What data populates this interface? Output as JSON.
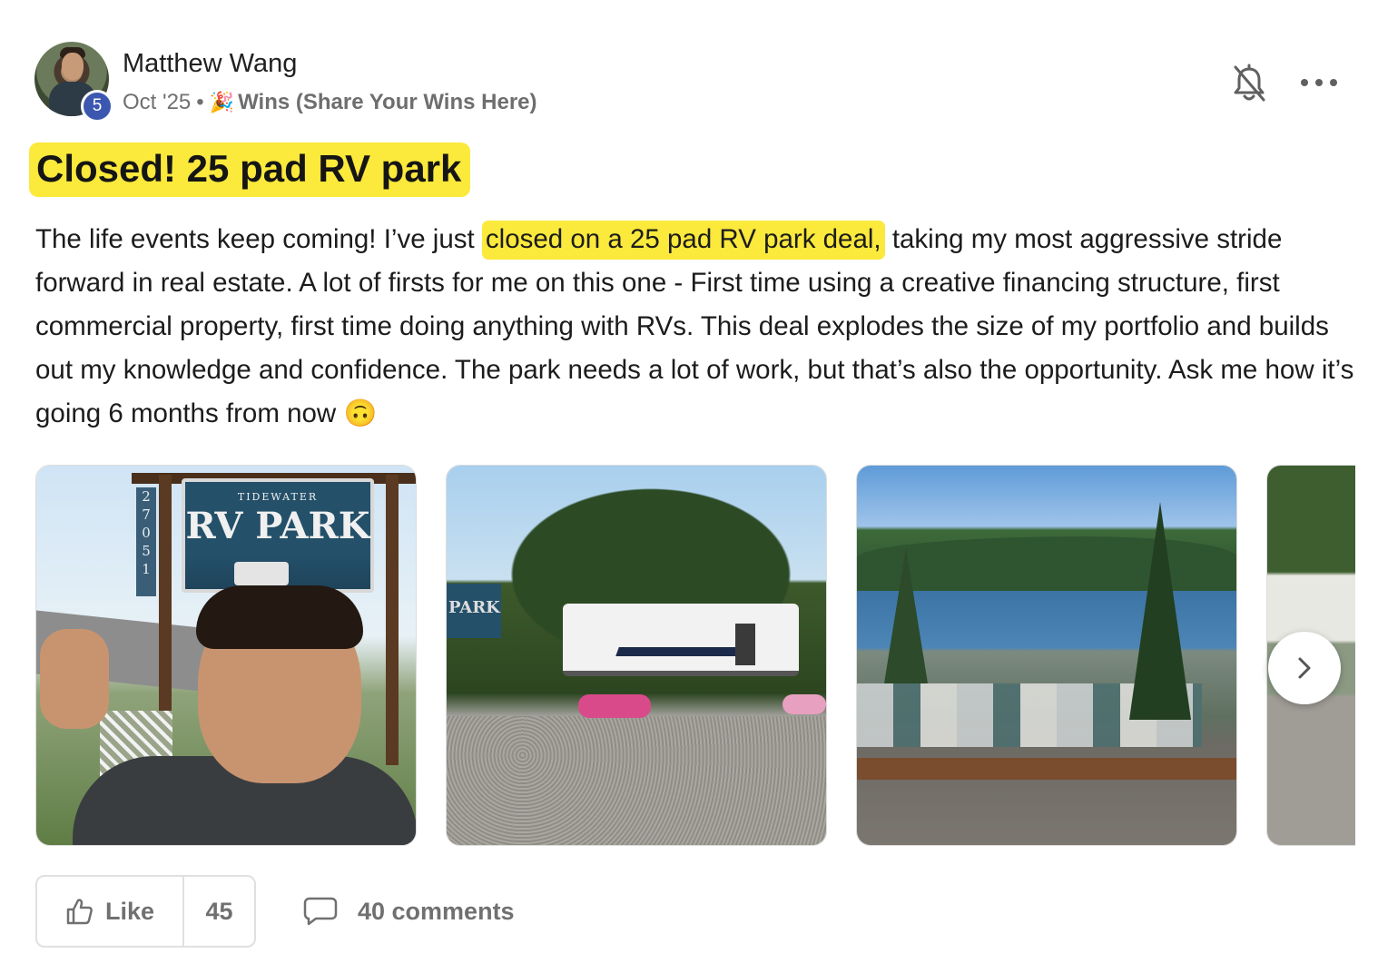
{
  "post": {
    "author": {
      "name": "Matthew Wang",
      "level": "5"
    },
    "date": "Oct '25",
    "separator": "•",
    "category_emoji": "🎉",
    "category": "Wins (Share Your Wins Here)",
    "title": "Closed! 25 pad RV park",
    "body": {
      "before_highlight": "The life events keep coming! I’ve just ",
      "highlight": "closed on a 25 pad RV park deal,",
      "after_highlight": " taking my most aggressive stride forward in real estate. A lot of firsts for me on this one - First time using a creative financing structure, first commercial property, first time doing anything with RVs. This deal explodes the size of my portfolio and builds out my knowledge and confidence. The park needs a lot of work, but that’s also the opportunity. Ask me how it’s going 6 months from now",
      "emoji": "🙃"
    },
    "photos": {
      "sign_small_text": "TIDEWATER",
      "sign_big_text": "RV PARK",
      "address_number": "27051",
      "photo2_sign_text": "PARK"
    },
    "actions": {
      "like_label": "Like",
      "like_count": "45",
      "comments_label": "40 comments"
    }
  },
  "icons": {
    "bell": "bell-muted-icon",
    "more": "more-horizontal-icon",
    "like": "thumbs-up-icon",
    "comment": "comment-bubble-icon",
    "next": "chevron-right-icon"
  },
  "colors": {
    "highlight": "#fbe93b",
    "level_badge": "#3b57b0",
    "muted_text": "#707070"
  }
}
